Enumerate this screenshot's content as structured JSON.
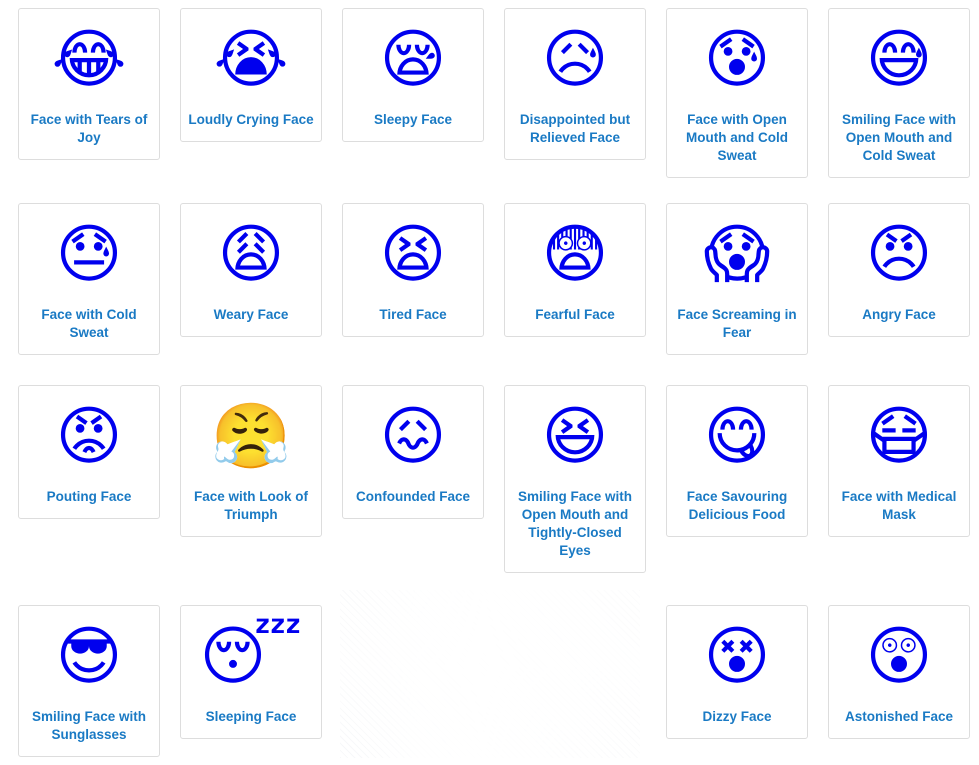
{
  "page": {
    "title": "Emoji List",
    "columns": 6,
    "link_color": "#1a7ac4",
    "card_border_color": "#dddddd",
    "background_color": "#ffffff"
  },
  "rows": [
    {
      "cells": [
        {
          "glyph": "😂",
          "icon": "face-with-tears-of-joy-icon",
          "label": "Face with Tears of Joy"
        },
        {
          "glyph": "😭",
          "icon": "loudly-crying-face-icon",
          "label": "Loudly Crying Face"
        },
        {
          "glyph": "😪",
          "icon": "sleepy-face-icon",
          "label": "Sleepy Face"
        },
        {
          "glyph": "😥",
          "icon": "disappointed-but-relieved-face-icon",
          "label": "Disappointed but Relieved Face"
        },
        {
          "glyph": "😰",
          "icon": "face-with-open-mouth-and-cold-sweat-icon",
          "label": "Face with Open Mouth and Cold Sweat"
        },
        {
          "glyph": "😅",
          "icon": "smiling-face-with-open-mouth-and-cold-sweat-icon",
          "label": "Smiling Face with Open Mouth and Cold Sweat"
        }
      ]
    },
    {
      "cells": [
        {
          "glyph": "😓",
          "icon": "face-with-cold-sweat-icon",
          "label": "Face with Cold Sweat"
        },
        {
          "glyph": "😩",
          "icon": "weary-face-icon",
          "label": "Weary Face"
        },
        {
          "glyph": "😫",
          "icon": "tired-face-icon",
          "label": "Tired Face"
        },
        {
          "glyph": "😨",
          "icon": "fearful-face-icon",
          "label": "Fearful Face"
        },
        {
          "glyph": "😱",
          "icon": "face-screaming-in-fear-icon",
          "label": "Face Screaming in Fear"
        },
        {
          "glyph": "😠",
          "icon": "angry-face-icon",
          "label": "Angry Face"
        }
      ]
    },
    {
      "cells": [
        {
          "glyph": "😡",
          "icon": "pouting-face-icon",
          "label": "Pouting Face"
        },
        {
          "glyph": "😤",
          "icon": "face-with-look-of-triumph-icon",
          "label": "Face with Look of Triumph"
        },
        {
          "glyph": "😖",
          "icon": "confounded-face-icon",
          "label": "Confounded Face"
        },
        {
          "glyph": "😆",
          "icon": "smiling-face-with-open-mouth-and-tightly-closed-eyes-icon",
          "label": "Smiling Face with Open Mouth and Tightly-Closed Eyes"
        },
        {
          "glyph": "😋",
          "icon": "face-savouring-delicious-food-icon",
          "label": "Face Savouring Delicious Food"
        },
        {
          "glyph": "😷",
          "icon": "face-with-medical-mask-icon",
          "label": "Face with Medical Mask"
        }
      ]
    },
    {
      "cells": [
        {
          "glyph": "😎",
          "icon": "smiling-face-with-sunglasses-icon",
          "label": "Smiling Face with Sunglasses"
        },
        {
          "glyph": "😴",
          "icon": "sleeping-face-icon",
          "label": "Sleeping Face"
        },
        {
          "empty": true
        },
        {
          "empty": true
        },
        {
          "glyph": "😵",
          "icon": "dizzy-face-icon",
          "label": "Dizzy Face"
        },
        {
          "glyph": "😲",
          "icon": "astonished-face-icon",
          "label": "Astonished Face"
        }
      ]
    }
  ]
}
